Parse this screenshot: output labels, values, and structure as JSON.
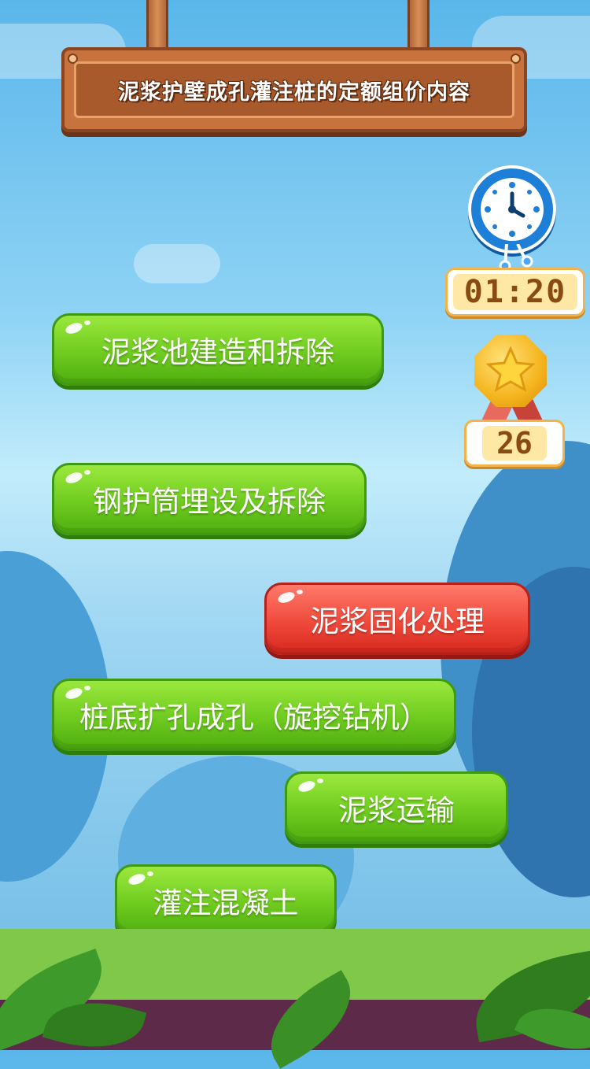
{
  "title": "泥浆护壁成孔灌注桩的定额组价内容",
  "timer": "01:20",
  "score": "26",
  "options": [
    {
      "label": "泥浆池建造和拆除",
      "state": "normal"
    },
    {
      "label": "钢护筒埋设及拆除",
      "state": "normal"
    },
    {
      "label": "泥浆固化处理",
      "state": "selected-wrong"
    },
    {
      "label": "桩底扩孔成孔（旋挖钻机）",
      "state": "normal"
    },
    {
      "label": "泥浆运输",
      "state": "normal"
    },
    {
      "label": "灌注混凝土",
      "state": "normal"
    }
  ],
  "colors": {
    "option_green": "#6fcb1f",
    "option_red": "#f04a3c",
    "sign_wood": "#c8733d",
    "clock_blue": "#1e7fd8",
    "medal_gold": "#f5b41d"
  },
  "icons": {
    "clock": "alarm-clock-icon",
    "medal": "medal-icon"
  }
}
